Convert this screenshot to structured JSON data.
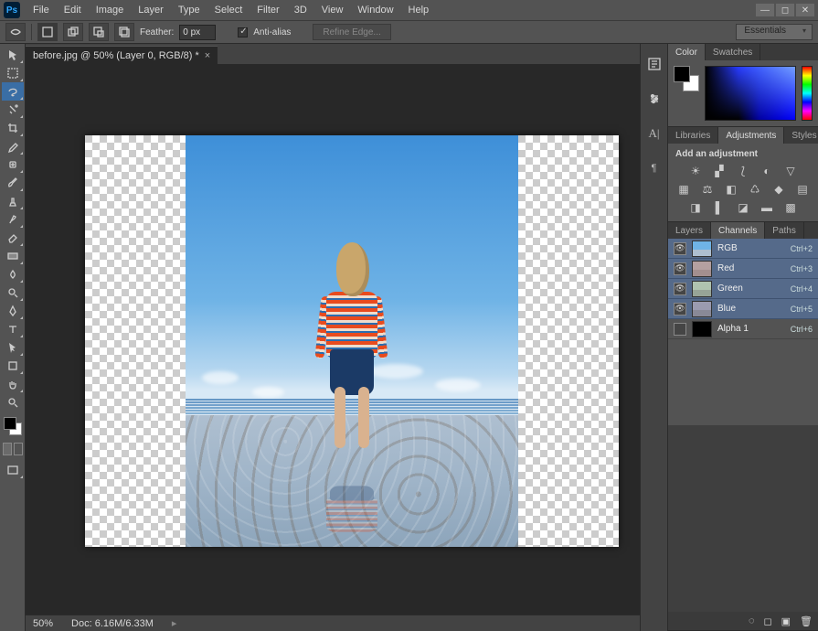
{
  "menu": {
    "items": [
      "File",
      "Edit",
      "Image",
      "Layer",
      "Type",
      "Select",
      "Filter",
      "3D",
      "View",
      "Window",
      "Help"
    ]
  },
  "options": {
    "feather_label": "Feather:",
    "feather_value": "0 px",
    "antialias_label": "Anti-alias",
    "refine_label": "Refine Edge..."
  },
  "workspace_switcher": "Essentials",
  "document": {
    "tab_title": "before.jpg @ 50% (Layer 0, RGB/8) *"
  },
  "status": {
    "zoom": "50%",
    "doc": "Doc: 6.16M/6.33M"
  },
  "panels": {
    "color_tab": "Color",
    "swatches_tab": "Swatches",
    "libraries_tab": "Libraries",
    "adjustments_tab": "Adjustments",
    "styles_tab": "Styles",
    "adjust_header": "Add an adjustment",
    "layers_tab": "Layers",
    "channels_tab": "Channels",
    "paths_tab": "Paths"
  },
  "channels": [
    {
      "name": "RGB",
      "shortcut": "Ctrl+2",
      "visible": true,
      "thumb": "rgb"
    },
    {
      "name": "Red",
      "shortcut": "Ctrl+3",
      "visible": true,
      "thumb": "r"
    },
    {
      "name": "Green",
      "shortcut": "Ctrl+4",
      "visible": true,
      "thumb": "g"
    },
    {
      "name": "Blue",
      "shortcut": "Ctrl+5",
      "visible": true,
      "thumb": "b"
    },
    {
      "name": "Alpha 1",
      "shortcut": "Ctrl+6",
      "visible": false,
      "thumb": "a"
    }
  ]
}
